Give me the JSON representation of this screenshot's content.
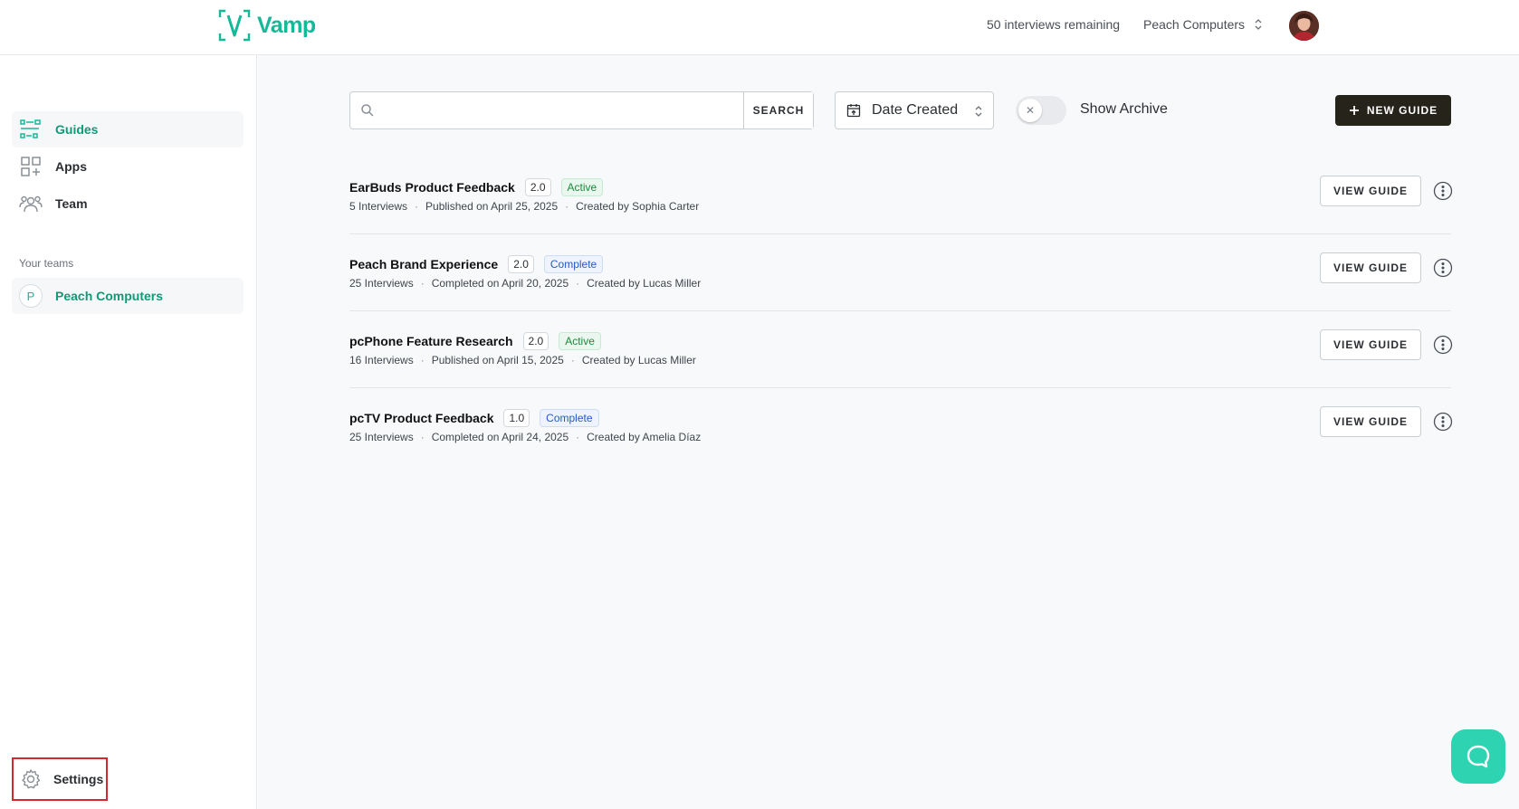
{
  "brand": {
    "name": "Vamp",
    "accent": "#17b897"
  },
  "header": {
    "remaining": "50 interviews remaining",
    "org": "Peach Computers"
  },
  "sidebar": {
    "items": [
      {
        "label": "Guides",
        "icon": "guides-icon"
      },
      {
        "label": "Apps",
        "icon": "apps-icon"
      },
      {
        "label": "Team",
        "icon": "team-icon"
      }
    ],
    "teams_label": "Your teams",
    "team": {
      "letter": "P",
      "name": "Peach Computers"
    },
    "settings_label": "Settings"
  },
  "toolbar": {
    "search_value": "",
    "search_placeholder": "",
    "search_label": "SEARCH",
    "sort_label": "Date Created",
    "archive_label": "Show Archive",
    "archive_on": false,
    "new_guide_label": "NEW GUIDE"
  },
  "guides": [
    {
      "title": "EarBuds Product Feedback",
      "version": "2.0",
      "status": "Active",
      "interviews": "5 Interviews",
      "date": "Published on April 25, 2025",
      "creator": "Created by Sophia Carter",
      "action": "VIEW GUIDE"
    },
    {
      "title": "Peach Brand Experience",
      "version": "2.0",
      "status": "Complete",
      "interviews": "25 Interviews",
      "date": "Completed on April 20, 2025",
      "creator": "Created by Lucas Miller",
      "action": "VIEW GUIDE"
    },
    {
      "title": "pcPhone Feature Research",
      "version": "2.0",
      "status": "Active",
      "interviews": "16 Interviews",
      "date": "Published on April 15, 2025",
      "creator": "Created by Lucas Miller",
      "action": "VIEW GUIDE"
    },
    {
      "title": "pcTV Product Feedback",
      "version": "1.0",
      "status": "Complete",
      "interviews": "25 Interviews",
      "date": "Completed on April 24, 2025",
      "creator": "Created by Amelia Díaz",
      "action": "VIEW GUIDE"
    }
  ],
  "separator": "·"
}
